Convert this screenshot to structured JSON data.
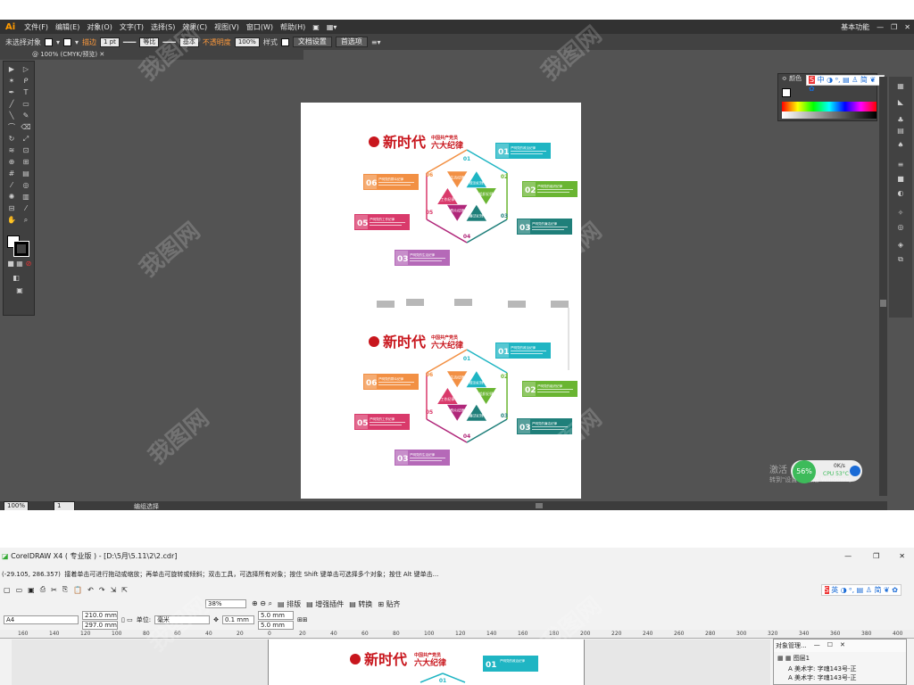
{
  "ai": {
    "logo": "Ai",
    "menu": [
      "文件(F)",
      "编辑(E)",
      "对象(O)",
      "文字(T)",
      "选择(S)",
      "效果(C)",
      "视图(V)",
      "窗口(W)",
      "帮助(H)"
    ],
    "workspace": "基本功能",
    "control": {
      "selection": "未选择对象",
      "stroke_label": "描边",
      "stroke_weight": "1 pt",
      "profile": "等比",
      "brush": "基本",
      "opacity_label": "不透明度",
      "opacity": "100%",
      "style_label": "样式",
      "doc_setup": "文档设置",
      "prefs": "首选项"
    },
    "tab": "@ 100% (CMYK/预览)",
    "zoom": "100%",
    "status": "编组选择",
    "panel_title": "颜色",
    "activation": {
      "line1": "激活",
      "line2": "转到\"设置\"以激活 Windows。",
      "gauge": "56%",
      "speed1": "0K/s",
      "speed2": "0K/s",
      "temp": "CPU 53°C"
    }
  },
  "art": {
    "title": "新时代",
    "sub1": "中国共产党员",
    "sub2": "六大纪律",
    "hex": [
      "政治纪律",
      "组织纪律",
      "廉洁纪律",
      "群众纪律",
      "工作纪律",
      "生活纪律"
    ],
    "nums": [
      "01",
      "02",
      "03",
      "04",
      "05",
      "06"
    ],
    "tags": [
      {
        "n": "01",
        "t": "严明党的政治纪律",
        "c": "#1fb5c3"
      },
      {
        "n": "02",
        "t": "严明党的组织纪律",
        "c": "#6ab532"
      },
      {
        "n": "03",
        "t": "严明党的廉洁纪律",
        "c": "#1f7f7a"
      },
      {
        "n": "03",
        "t": "严明党的生活纪律",
        "c": "#b569b8"
      },
      {
        "n": "05",
        "t": "严明党的工作纪律",
        "c": "#d93a6b"
      },
      {
        "n": "06",
        "t": "严明党的群众纪律",
        "c": "#f29044"
      }
    ]
  },
  "cd": {
    "title": "CorelDRAW X4 ( 专业版 ) - [D:\\5月\\5.11\\2\\2.cdr]",
    "coords": "(-29.105, 286.357)",
    "hint": "接着单击可进行拖动或缩放；再单击可旋转或倾斜；双击工具，可选择所有对象；按住 Shift 键单击可选择多个对象；按住 Alt 键单击...",
    "zoom": "38%",
    "toolbar": [
      "排版",
      "增强插件",
      "转换",
      "贴齐"
    ],
    "page": "A4",
    "w": "210.0 mm",
    "h": "297.0 mm",
    "unit_label": "单位:",
    "unit": "毫米",
    "nudge": "0.1 mm",
    "dup_x": "5.0 mm",
    "dup_y": "5.0 mm",
    "ruler": [
      "160",
      "140",
      "120",
      "100",
      "80",
      "60",
      "40",
      "20",
      "0",
      "20",
      "40",
      "60",
      "80",
      "100",
      "120",
      "140",
      "160",
      "180",
      "200",
      "220",
      "240",
      "260",
      "280",
      "300",
      "320",
      "340",
      "360",
      "380",
      "400"
    ],
    "objmgr": {
      "title": "对象管理...",
      "items": [
        "美术字: 字魂143号-正",
        "美术字: 字魂143号-正"
      ],
      "l1": "图层1"
    }
  },
  "ime": [
    "英",
    "中"
  ]
}
